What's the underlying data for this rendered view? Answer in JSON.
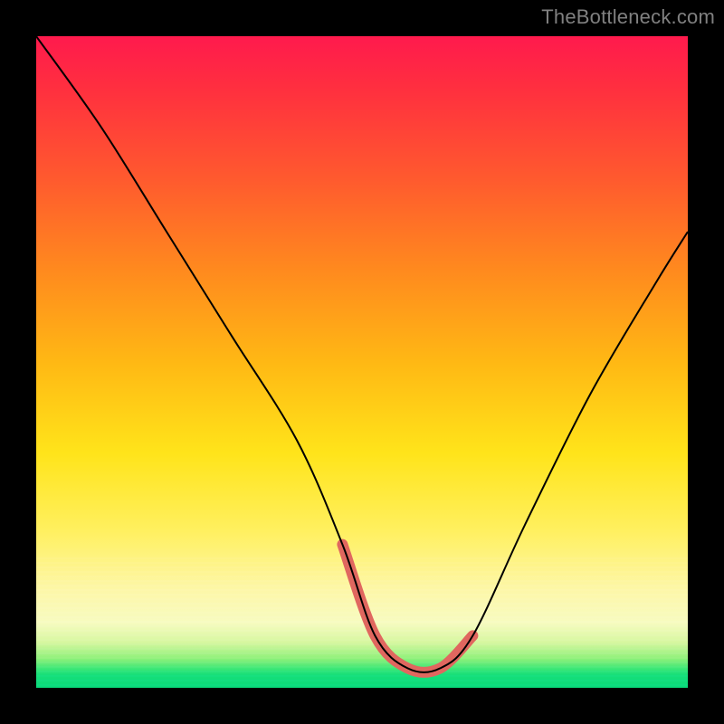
{
  "watermark": "TheBottleneck.com",
  "chart_data": {
    "type": "line",
    "title": "",
    "xlabel": "",
    "ylabel": "",
    "xlim": [
      0,
      100
    ],
    "ylim": [
      0,
      100
    ],
    "grid": false,
    "legend": false,
    "series": [
      {
        "name": "bottleneck-curve",
        "x": [
          0,
          10,
          20,
          30,
          40,
          47,
          52,
          57,
          62,
          67,
          75,
          85,
          95,
          100
        ],
        "values": [
          100,
          86,
          70,
          54,
          38,
          22,
          8,
          3,
          3,
          8,
          25,
          45,
          62,
          70
        ]
      }
    ],
    "highlight_range": {
      "x": [
        48,
        66
      ],
      "color": "#e0675f",
      "description": "optimal-region-marker"
    },
    "background_gradient_stops": [
      {
        "pos": 0,
        "color": "#ff1a4d"
      },
      {
        "pos": 22,
        "color": "#ff5a2e"
      },
      {
        "pos": 50,
        "color": "#ffb814"
      },
      {
        "pos": 76,
        "color": "#fff060"
      },
      {
        "pos": 90,
        "color": "#f7fbc0"
      },
      {
        "pos": 97,
        "color": "#3fe776"
      },
      {
        "pos": 100,
        "color": "#0ad97a"
      }
    ]
  }
}
